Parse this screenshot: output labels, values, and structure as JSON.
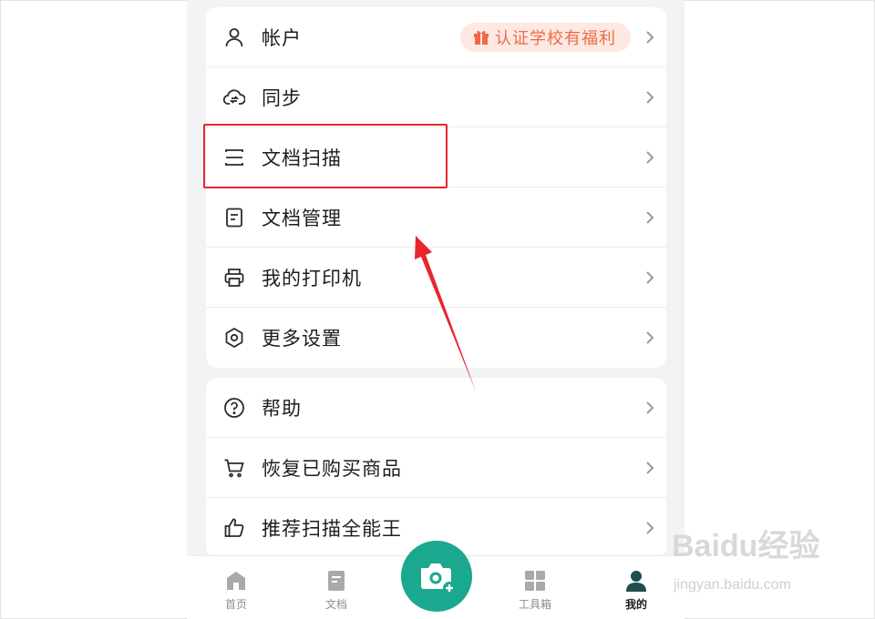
{
  "menu_group_1": [
    {
      "icon": "user-icon",
      "label": "帐户",
      "badge": {
        "icon": "gift-icon",
        "text": "认证学校有福利"
      }
    },
    {
      "icon": "cloud-sync-icon",
      "label": "同步"
    },
    {
      "icon": "scan-icon",
      "label": "文档扫描"
    },
    {
      "icon": "document-icon",
      "label": "文档管理"
    },
    {
      "icon": "printer-icon",
      "label": "我的打印机"
    },
    {
      "icon": "gear-icon",
      "label": "更多设置"
    }
  ],
  "menu_group_2": [
    {
      "icon": "help-icon",
      "label": "帮助"
    },
    {
      "icon": "cart-icon",
      "label": "恢复已购买商品"
    },
    {
      "icon": "thumbs-up-icon",
      "label": "推荐扫描全能王"
    }
  ],
  "tabbar": {
    "home": "首页",
    "docs": "文档",
    "tools": "工具箱",
    "me": "我的",
    "active": "me",
    "camera_icon": "camera-plus-icon"
  },
  "annotation": {
    "highlight_color": "#e6262c",
    "arrow_color": "#e6262c"
  },
  "colors": {
    "accent": "#1aa88e",
    "badge_text": "#ee6a47",
    "badge_bg": "#fde8e2",
    "background": "#f2f3f5"
  },
  "watermark": {
    "brand": "Baidu经验",
    "url": "jingyan.baidu.com"
  }
}
